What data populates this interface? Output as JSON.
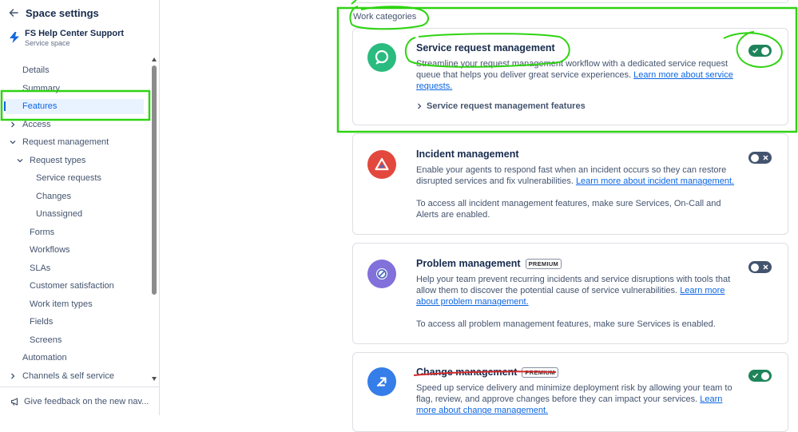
{
  "sidebar": {
    "title": "Space settings",
    "space_name": "FS Help Center Support",
    "space_type": "Service space",
    "items": [
      {
        "label": "Details"
      },
      {
        "label": "Summary"
      },
      {
        "label": "Features",
        "active": true
      },
      {
        "label": "Access",
        "chevron": "right"
      },
      {
        "label": "Request management",
        "chevron": "down"
      },
      {
        "label": "Request types",
        "chevron": "down"
      },
      {
        "label": "Service requests"
      },
      {
        "label": "Changes"
      },
      {
        "label": "Unassigned"
      },
      {
        "label": "Forms"
      },
      {
        "label": "Workflows"
      },
      {
        "label": "SLAs"
      },
      {
        "label": "Customer satisfaction"
      },
      {
        "label": "Work item types"
      },
      {
        "label": "Fields"
      },
      {
        "label": "Screens"
      },
      {
        "label": "Automation"
      },
      {
        "label": "Channels & self service",
        "chevron": "right"
      }
    ],
    "feedback_label": "Give feedback on the new nav..."
  },
  "main": {
    "section_label": "Work categories",
    "cards": [
      {
        "title": "Service request management",
        "description": "Streamline your request management workflow with a dedicated service request queue that helps you deliver great service experiences.",
        "link": "Learn more about service requests.",
        "expander": "Service request management features",
        "enabled": true,
        "icon": "chat-bubble-icon",
        "icon_color": "#2ABB7F"
      },
      {
        "title": "Incident management",
        "description": "Enable your agents to respond fast when an incident occurs so they can restore disrupted services and fix vulnerabilities.",
        "link": "Learn more about incident management.",
        "note": "To access all incident management features, make sure Services, On-Call and Alerts are enabled.",
        "enabled": false,
        "icon": "warning-triangle-icon",
        "icon_color": "#E2483D"
      },
      {
        "title": "Problem management",
        "badge": "PREMIUM",
        "description": "Help your team prevent recurring incidents and service disruptions with tools that allow them to discover the potential cause of service vulnerabilities.",
        "link": "Learn more about problem management.",
        "note": "To access all problem management features, make sure Services is enabled.",
        "enabled": false,
        "icon": "prohibited-icon",
        "icon_color": "#8270DB"
      },
      {
        "title": "Change management",
        "badge": "PREMIUM",
        "description": "Speed up service delivery and minimize deployment risk by allowing your team to flag, review, and approve changes before they can impact your services.",
        "link": "Learn more about change management.",
        "enabled": true,
        "icon": "change-arrows-icon",
        "icon_color": "#357DE8"
      }
    ]
  },
  "colors": {
    "annotation_green": "#2FD312",
    "annotation_red": "#D42A2A",
    "link": "#0C66E4",
    "toggle_on": "#1F845A",
    "toggle_off": "#44546F"
  }
}
